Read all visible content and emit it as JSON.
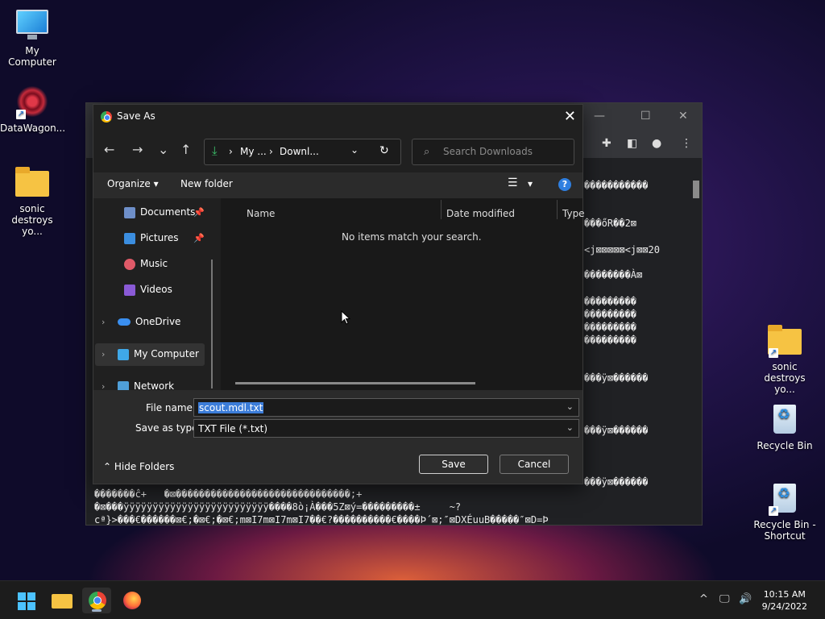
{
  "desktop": {
    "icons_left": [
      {
        "label": "My Computer",
        "icon": "monitor-icon"
      },
      {
        "label": "DataWagon...",
        "icon": "datawagon-logo-icon"
      },
      {
        "label_line1": "sonic",
        "label_line2": "destroys yo...",
        "icon": "folder-icon"
      }
    ],
    "icons_right": [
      {
        "label_line1": "sonic",
        "label_line2": "destroys yo...",
        "icon": "folder-icon"
      },
      {
        "label": "Recycle Bin",
        "icon": "recycle-bin-icon"
      },
      {
        "label_line1": "Recycle Bin -",
        "label_line2": "Shortcut",
        "icon": "recycle-bin-icon"
      }
    ]
  },
  "browser_bg": {
    "garbled_lines": [
      "�����������",
      "���őR��2⊠",
      "<j⊠⊠⊠⊠⊠<j⊠⊠20",
      "��������À⊠",
      "���������",
      "���������",
      "���������",
      "���������",
      "���ÿ⊠������",
      "���ÿ⊠������",
      "���ÿ⊠������",
      "�������ĉ+   �⊠������������������������������;+",
      "�⊠���ÿÿÿÿÿÿÿÿÿÿÿÿÿÿÿÿÿÿÿÿÿÿÿÿÿ����8ò¡À���5Z⊠ý=���������±     ~?",
      "cª}>���€������⊠€;�⊠€;�⊠€;m⊠I7m⊠I7m⊠I7��€?����������€����Þ´⊠;″⊠DXÉuuB�����″⊠D=Þ"
    ]
  },
  "dialog": {
    "title": "Save As",
    "close_glyph": "✕",
    "nav": {
      "back": "←",
      "forward": "→",
      "recent": "⌄",
      "up": "↑"
    },
    "address": {
      "segment1": "My ...",
      "segment2": "Downl...",
      "separator": "›",
      "dropdown": "⌄",
      "refresh": "↻"
    },
    "search": {
      "placeholder": "Search Downloads"
    },
    "commands": {
      "organize": "Organize ▾",
      "new_folder": "New folder",
      "view_dropdown": "▾",
      "help": "?"
    },
    "nav_pane": {
      "items": [
        {
          "label": "Documents",
          "icon": "documents-icon",
          "pinned": true,
          "color": "#6e8fc9"
        },
        {
          "label": "Pictures",
          "icon": "pictures-icon",
          "pinned": true,
          "color": "#3b8ee0"
        },
        {
          "label": "Music",
          "icon": "music-icon",
          "pinned": false,
          "color": "#e05a68"
        },
        {
          "label": "Videos",
          "icon": "videos-icon",
          "pinned": false,
          "color": "#8a5ad6"
        },
        {
          "label": "OneDrive",
          "icon": "onedrive-icon",
          "pinned": false,
          "color": "#3a8ff0"
        },
        {
          "label": "My Computer",
          "icon": "computer-icon",
          "pinned": false,
          "color": "#3fa8e8"
        },
        {
          "label": "Network",
          "icon": "network-icon",
          "pinned": false,
          "color": "#4f9fd8"
        }
      ],
      "selected": "My Computer"
    },
    "columns": [
      "Name",
      "Date modified",
      "Type"
    ],
    "empty_message": "No items match your search.",
    "file_name_label": "File name:",
    "file_name_value": "scout.mdl.txt",
    "save_type_label": "Save as type:",
    "save_type_value": "TXT File (*.txt)",
    "hide_folders": "Hide Folders",
    "save_button": "Save",
    "cancel_button": "Cancel"
  },
  "taskbar": {
    "clock_time": "10:15 AM",
    "clock_date": "9/24/2022",
    "tray_chevron": "^",
    "accent": "#4cc2ff"
  }
}
